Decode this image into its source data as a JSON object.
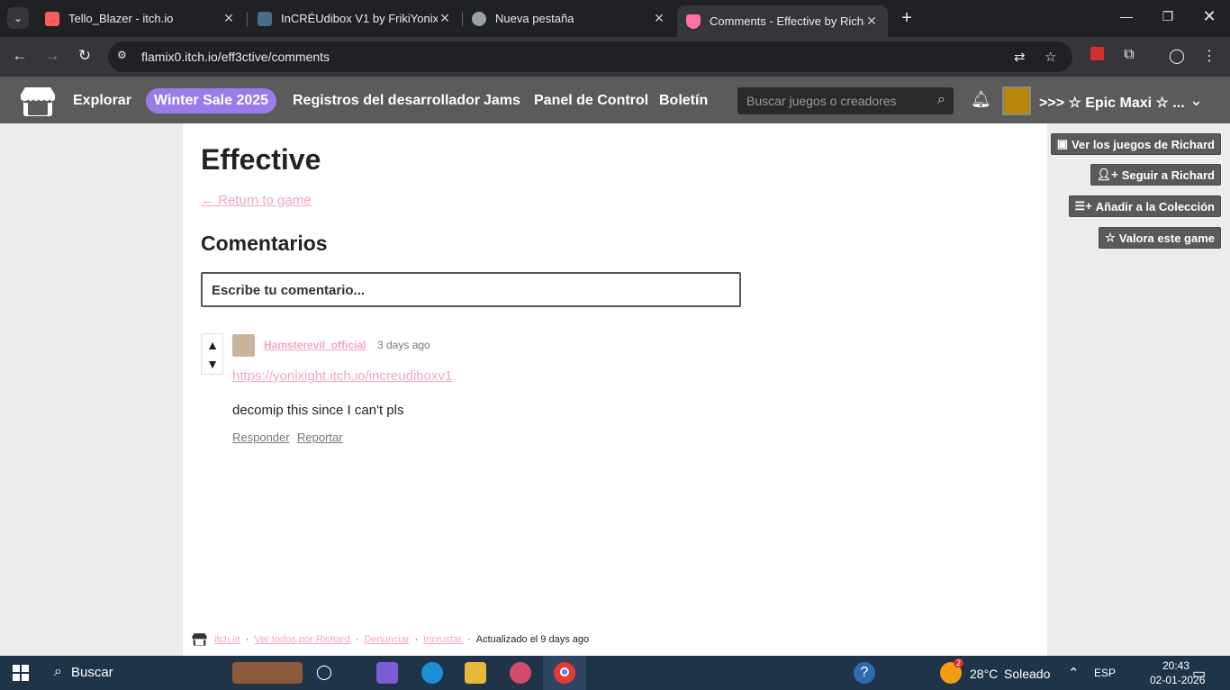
{
  "browser": {
    "tabs": [
      {
        "title": "Tello_Blazer - itch.io",
        "color": "#fa5c5c"
      },
      {
        "title": "InCRÉUdibox V1 by FrikiYonix",
        "color": "#4a6a8a"
      },
      {
        "title": "Nueva pestaña",
        "color": "#9aa0a6"
      },
      {
        "title": "Comments - Effective by Richard",
        "color": "#ff6fa8"
      }
    ],
    "url": "flamix0.itch.io/eff3ctive/comments"
  },
  "header": {
    "nav": [
      "Explorar",
      "Winter Sale 2025",
      "Registros del desarrollador",
      "Jams",
      "Panel de Control",
      "Boletín"
    ],
    "search_placeholder": "Buscar juegos o creadores",
    "username": ">>> ☆ Epic Maxi ☆ ..."
  },
  "sidebar": {
    "buttons": [
      {
        "label": "Ver los juegos de Richard",
        "icon": "itch-icon"
      },
      {
        "label": "Seguir a Richard",
        "icon": "add-user-icon"
      },
      {
        "label": "Añadir a la Colección",
        "icon": "add-list-icon"
      },
      {
        "label": "Valora este game",
        "icon": "star-icon"
      }
    ]
  },
  "main": {
    "title": "Effective",
    "return_link": "← Return to game",
    "comments_title": "Comentarios",
    "comment_placeholder": "Escribe tu comentario..."
  },
  "comment": {
    "user": "Hamsterevil_official",
    "time": "3 days ago",
    "link": "https://yonixight.itch.io/increudiboxv1",
    "text": "decomip this since I can't pls",
    "reply": "Responder",
    "report": "Reportar"
  },
  "footer": {
    "site": "itch.io",
    "all_by": "Ver todos por Richard",
    "report": "Denunciar",
    "embed": "Incrustar",
    "updated": "Actualizado el 9 days ago"
  },
  "taskbar": {
    "search": "Buscar",
    "weather_temp": "28°C",
    "weather_text": "Soleado",
    "weather_badge": "2",
    "lang": "ESP",
    "time": "20:43",
    "date": "02-01-2026"
  },
  "colors": {
    "link_pink": "#f4a7c0",
    "sale_purple": "#9b7bea",
    "header_gray": "#5b5b5b"
  }
}
